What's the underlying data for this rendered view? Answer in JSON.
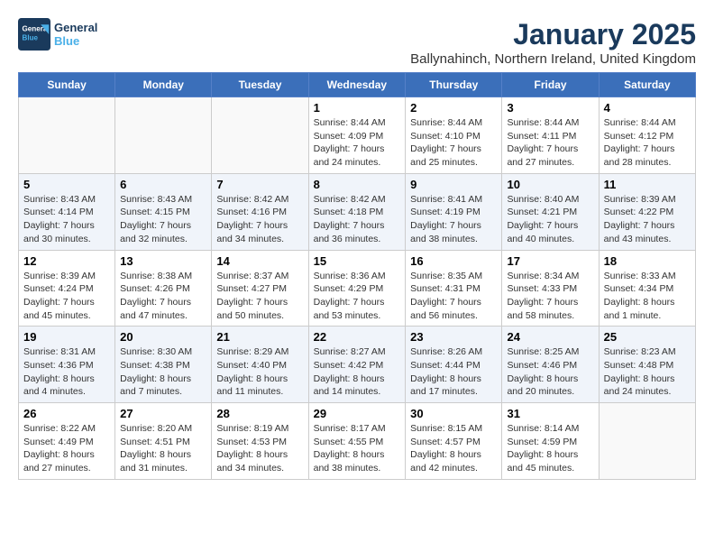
{
  "logo": {
    "name": "General",
    "name2": "Blue"
  },
  "title": "January 2025",
  "subtitle": "Ballynahinch, Northern Ireland, United Kingdom",
  "days_of_week": [
    "Sunday",
    "Monday",
    "Tuesday",
    "Wednesday",
    "Thursday",
    "Friday",
    "Saturday"
  ],
  "weeks": [
    {
      "days": [
        {
          "num": "",
          "info": ""
        },
        {
          "num": "",
          "info": ""
        },
        {
          "num": "",
          "info": ""
        },
        {
          "num": "1",
          "info": "Sunrise: 8:44 AM\nSunset: 4:09 PM\nDaylight: 7 hours\nand 24 minutes."
        },
        {
          "num": "2",
          "info": "Sunrise: 8:44 AM\nSunset: 4:10 PM\nDaylight: 7 hours\nand 25 minutes."
        },
        {
          "num": "3",
          "info": "Sunrise: 8:44 AM\nSunset: 4:11 PM\nDaylight: 7 hours\nand 27 minutes."
        },
        {
          "num": "4",
          "info": "Sunrise: 8:44 AM\nSunset: 4:12 PM\nDaylight: 7 hours\nand 28 minutes."
        }
      ]
    },
    {
      "days": [
        {
          "num": "5",
          "info": "Sunrise: 8:43 AM\nSunset: 4:14 PM\nDaylight: 7 hours\nand 30 minutes."
        },
        {
          "num": "6",
          "info": "Sunrise: 8:43 AM\nSunset: 4:15 PM\nDaylight: 7 hours\nand 32 minutes."
        },
        {
          "num": "7",
          "info": "Sunrise: 8:42 AM\nSunset: 4:16 PM\nDaylight: 7 hours\nand 34 minutes."
        },
        {
          "num": "8",
          "info": "Sunrise: 8:42 AM\nSunset: 4:18 PM\nDaylight: 7 hours\nand 36 minutes."
        },
        {
          "num": "9",
          "info": "Sunrise: 8:41 AM\nSunset: 4:19 PM\nDaylight: 7 hours\nand 38 minutes."
        },
        {
          "num": "10",
          "info": "Sunrise: 8:40 AM\nSunset: 4:21 PM\nDaylight: 7 hours\nand 40 minutes."
        },
        {
          "num": "11",
          "info": "Sunrise: 8:39 AM\nSunset: 4:22 PM\nDaylight: 7 hours\nand 43 minutes."
        }
      ]
    },
    {
      "days": [
        {
          "num": "12",
          "info": "Sunrise: 8:39 AM\nSunset: 4:24 PM\nDaylight: 7 hours\nand 45 minutes."
        },
        {
          "num": "13",
          "info": "Sunrise: 8:38 AM\nSunset: 4:26 PM\nDaylight: 7 hours\nand 47 minutes."
        },
        {
          "num": "14",
          "info": "Sunrise: 8:37 AM\nSunset: 4:27 PM\nDaylight: 7 hours\nand 50 minutes."
        },
        {
          "num": "15",
          "info": "Sunrise: 8:36 AM\nSunset: 4:29 PM\nDaylight: 7 hours\nand 53 minutes."
        },
        {
          "num": "16",
          "info": "Sunrise: 8:35 AM\nSunset: 4:31 PM\nDaylight: 7 hours\nand 56 minutes."
        },
        {
          "num": "17",
          "info": "Sunrise: 8:34 AM\nSunset: 4:33 PM\nDaylight: 7 hours\nand 58 minutes."
        },
        {
          "num": "18",
          "info": "Sunrise: 8:33 AM\nSunset: 4:34 PM\nDaylight: 8 hours\nand 1 minute."
        }
      ]
    },
    {
      "days": [
        {
          "num": "19",
          "info": "Sunrise: 8:31 AM\nSunset: 4:36 PM\nDaylight: 8 hours\nand 4 minutes."
        },
        {
          "num": "20",
          "info": "Sunrise: 8:30 AM\nSunset: 4:38 PM\nDaylight: 8 hours\nand 7 minutes."
        },
        {
          "num": "21",
          "info": "Sunrise: 8:29 AM\nSunset: 4:40 PM\nDaylight: 8 hours\nand 11 minutes."
        },
        {
          "num": "22",
          "info": "Sunrise: 8:27 AM\nSunset: 4:42 PM\nDaylight: 8 hours\nand 14 minutes."
        },
        {
          "num": "23",
          "info": "Sunrise: 8:26 AM\nSunset: 4:44 PM\nDaylight: 8 hours\nand 17 minutes."
        },
        {
          "num": "24",
          "info": "Sunrise: 8:25 AM\nSunset: 4:46 PM\nDaylight: 8 hours\nand 20 minutes."
        },
        {
          "num": "25",
          "info": "Sunrise: 8:23 AM\nSunset: 4:48 PM\nDaylight: 8 hours\nand 24 minutes."
        }
      ]
    },
    {
      "days": [
        {
          "num": "26",
          "info": "Sunrise: 8:22 AM\nSunset: 4:49 PM\nDaylight: 8 hours\nand 27 minutes."
        },
        {
          "num": "27",
          "info": "Sunrise: 8:20 AM\nSunset: 4:51 PM\nDaylight: 8 hours\nand 31 minutes."
        },
        {
          "num": "28",
          "info": "Sunrise: 8:19 AM\nSunset: 4:53 PM\nDaylight: 8 hours\nand 34 minutes."
        },
        {
          "num": "29",
          "info": "Sunrise: 8:17 AM\nSunset: 4:55 PM\nDaylight: 8 hours\nand 38 minutes."
        },
        {
          "num": "30",
          "info": "Sunrise: 8:15 AM\nSunset: 4:57 PM\nDaylight: 8 hours\nand 42 minutes."
        },
        {
          "num": "31",
          "info": "Sunrise: 8:14 AM\nSunset: 4:59 PM\nDaylight: 8 hours\nand 45 minutes."
        },
        {
          "num": "",
          "info": ""
        }
      ]
    }
  ]
}
